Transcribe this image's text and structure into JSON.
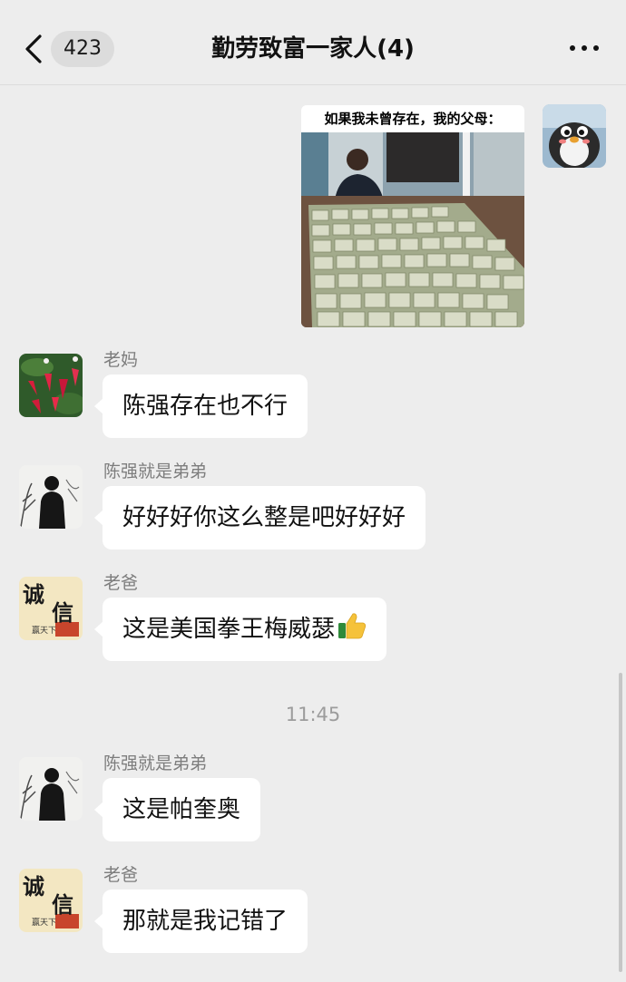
{
  "header": {
    "unread_count": "423",
    "title": "勤劳致富一家人(4)"
  },
  "meme": {
    "caption": "如果我未曾存在，我的父母："
  },
  "messages": [
    {
      "sender": "老妈",
      "text": "陈强存在也不行",
      "avatar": "flower-avatar"
    },
    {
      "sender": "陈强就是弟弟",
      "text": "好好好你这么整是吧好好好",
      "avatar": "ink-figure-avatar"
    },
    {
      "sender": "老爸",
      "text": "这是美国拳王梅威瑟",
      "avatar": "chengxin-calligraphy-avatar",
      "emoji": "thumbs-up-icon"
    },
    {
      "sender": "陈强就是弟弟",
      "text": "这是帕奎奥",
      "avatar": "ink-figure-avatar"
    },
    {
      "sender": "老爸",
      "text": "那就是我记错了",
      "avatar": "chengxin-calligraphy-avatar"
    }
  ],
  "timestamp": "11:45",
  "avatar_text": {
    "chengxin_main": "诚",
    "chengxin_second": "信",
    "chengxin_small": "赢天下"
  }
}
